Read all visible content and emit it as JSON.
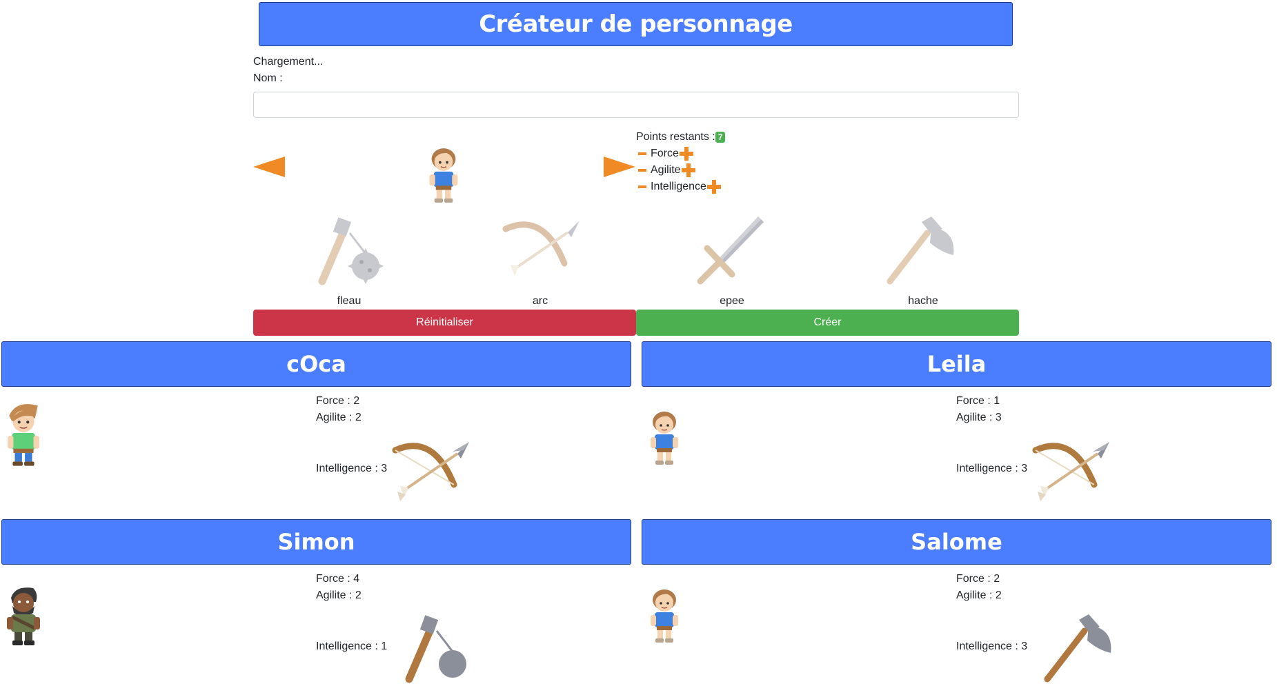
{
  "header": {
    "title": "Créateur de personnage"
  },
  "form": {
    "loading_text": "Chargement...",
    "name_label": "Nom :",
    "name_value": "",
    "points_label": "Points restants :",
    "points_value": "7",
    "stats": [
      {
        "label": "Force"
      },
      {
        "label": "Agilite"
      },
      {
        "label": "Intelligence"
      }
    ],
    "weapons": [
      {
        "label": "fleau"
      },
      {
        "label": "arc"
      },
      {
        "label": "epee"
      },
      {
        "label": "hache"
      }
    ],
    "reset_label": "Réinitialiser",
    "create_label": "Créer"
  },
  "characters": [
    {
      "name": "cOca",
      "force": "Force : 2",
      "agilite": "Agilite : 2",
      "intelligence": "Intelligence : 3"
    },
    {
      "name": "Leila",
      "force": "Force : 1",
      "agilite": "Agilite : 3",
      "intelligence": "Intelligence : 3"
    },
    {
      "name": "Simon",
      "force": "Force : 4",
      "agilite": "Agilite : 2",
      "intelligence": "Intelligence : 1"
    },
    {
      "name": "Salome",
      "force": "Force : 2",
      "agilite": "Agilite : 2",
      "intelligence": "Intelligence : 3"
    }
  ],
  "colors": {
    "banner": "#4a7dff",
    "accent": "#f08a24",
    "reset": "#cc3547",
    "create": "#4caf50"
  }
}
